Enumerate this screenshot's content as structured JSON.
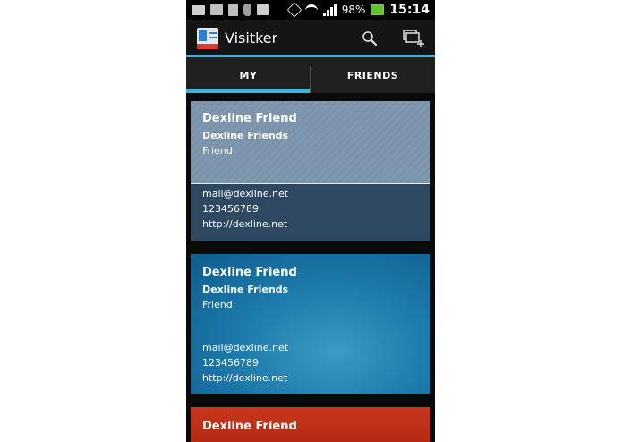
{
  "status_bar": {
    "battery": "98%",
    "time": "15:14"
  },
  "app": {
    "title": "Visitker"
  },
  "tabs": [
    {
      "label": "MY",
      "active": true
    },
    {
      "label": "FRIENDS",
      "active": false
    }
  ],
  "cards": [
    {
      "name": "Dexline Friend",
      "company": "Dexline Friends",
      "role": "Friend",
      "email": "mail@dexline.net",
      "phone": "123456789",
      "web": "http://dexline.net",
      "theme": "grey-blue"
    },
    {
      "name": "Dexline Friend",
      "company": "Dexline Friends",
      "role": "Friend",
      "email": "mail@dexline.net",
      "phone": "123456789",
      "web": "http://dexline.net",
      "theme": "blue"
    },
    {
      "name": "Dexline Friend",
      "theme": "red"
    }
  ],
  "colors": {
    "accent": "#33b5e5",
    "actionbar": "#151515"
  },
  "icons": {
    "search": "search-icon",
    "add": "add-card-icon"
  }
}
